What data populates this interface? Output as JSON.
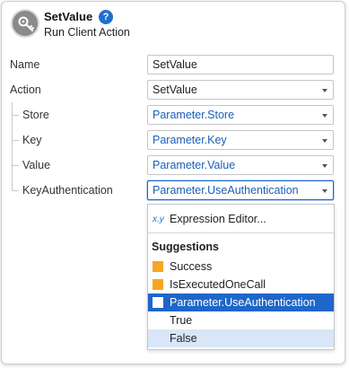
{
  "header": {
    "title": "SetValue",
    "help_glyph": "?",
    "subtitle": "Run Client Action",
    "icon": "key-icon"
  },
  "properties": [
    {
      "label": "Name",
      "value": "SetValue",
      "style": "plain",
      "has_caret": false
    },
    {
      "label": "Action",
      "value": "SetValue",
      "style": "plain",
      "has_caret": true
    },
    {
      "label": "Store",
      "value": "Parameter.Store",
      "style": "link",
      "has_caret": true
    },
    {
      "label": "Key",
      "value": "Parameter.Key",
      "style": "link",
      "has_caret": true
    },
    {
      "label": "Value",
      "value": "Parameter.Value",
      "style": "link",
      "has_caret": true
    },
    {
      "label": "KeyAuthentication",
      "value": "Parameter.UseAuthentication",
      "style": "link",
      "has_caret": true,
      "active": true
    }
  ],
  "dropdown": {
    "expression_icon": "x.y",
    "expression_label": "Expression Editor...",
    "suggestions_heading": "Suggestions",
    "items": [
      {
        "label": "Success",
        "icon": "orange-square-icon",
        "state": "normal"
      },
      {
        "label": "IsExecutedOneCall",
        "icon": "orange-square-icon",
        "state": "normal"
      },
      {
        "label": "Parameter.UseAuthentication",
        "icon": "white-square-icon",
        "state": "selected"
      },
      {
        "label": "True",
        "icon": "",
        "state": "normal"
      },
      {
        "label": "False",
        "icon": "",
        "state": "hover"
      }
    ]
  },
  "colors": {
    "accent": "#1e66c9",
    "link_text": "#1a5fb4",
    "variable_icon": "#f5a623",
    "hover_row": "#d8e6f8"
  }
}
